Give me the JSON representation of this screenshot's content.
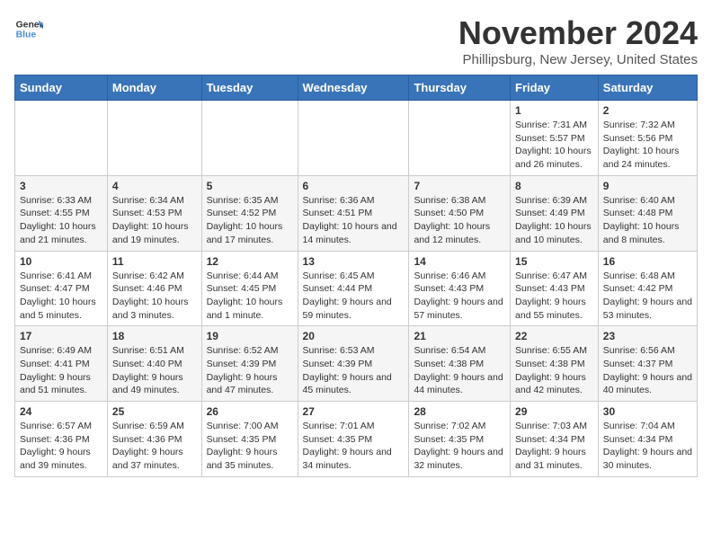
{
  "logo": {
    "line1": "General",
    "line2": "Blue"
  },
  "title": "November 2024",
  "subtitle": "Phillipsburg, New Jersey, United States",
  "days_of_week": [
    "Sunday",
    "Monday",
    "Tuesday",
    "Wednesday",
    "Thursday",
    "Friday",
    "Saturday"
  ],
  "weeks": [
    [
      {
        "day": "",
        "info": ""
      },
      {
        "day": "",
        "info": ""
      },
      {
        "day": "",
        "info": ""
      },
      {
        "day": "",
        "info": ""
      },
      {
        "day": "",
        "info": ""
      },
      {
        "day": "1",
        "info": "Sunrise: 7:31 AM\nSunset: 5:57 PM\nDaylight: 10 hours and 26 minutes."
      },
      {
        "day": "2",
        "info": "Sunrise: 7:32 AM\nSunset: 5:56 PM\nDaylight: 10 hours and 24 minutes."
      }
    ],
    [
      {
        "day": "3",
        "info": "Sunrise: 6:33 AM\nSunset: 4:55 PM\nDaylight: 10 hours and 21 minutes."
      },
      {
        "day": "4",
        "info": "Sunrise: 6:34 AM\nSunset: 4:53 PM\nDaylight: 10 hours and 19 minutes."
      },
      {
        "day": "5",
        "info": "Sunrise: 6:35 AM\nSunset: 4:52 PM\nDaylight: 10 hours and 17 minutes."
      },
      {
        "day": "6",
        "info": "Sunrise: 6:36 AM\nSunset: 4:51 PM\nDaylight: 10 hours and 14 minutes."
      },
      {
        "day": "7",
        "info": "Sunrise: 6:38 AM\nSunset: 4:50 PM\nDaylight: 10 hours and 12 minutes."
      },
      {
        "day": "8",
        "info": "Sunrise: 6:39 AM\nSunset: 4:49 PM\nDaylight: 10 hours and 10 minutes."
      },
      {
        "day": "9",
        "info": "Sunrise: 6:40 AM\nSunset: 4:48 PM\nDaylight: 10 hours and 8 minutes."
      }
    ],
    [
      {
        "day": "10",
        "info": "Sunrise: 6:41 AM\nSunset: 4:47 PM\nDaylight: 10 hours and 5 minutes."
      },
      {
        "day": "11",
        "info": "Sunrise: 6:42 AM\nSunset: 4:46 PM\nDaylight: 10 hours and 3 minutes."
      },
      {
        "day": "12",
        "info": "Sunrise: 6:44 AM\nSunset: 4:45 PM\nDaylight: 10 hours and 1 minute."
      },
      {
        "day": "13",
        "info": "Sunrise: 6:45 AM\nSunset: 4:44 PM\nDaylight: 9 hours and 59 minutes."
      },
      {
        "day": "14",
        "info": "Sunrise: 6:46 AM\nSunset: 4:43 PM\nDaylight: 9 hours and 57 minutes."
      },
      {
        "day": "15",
        "info": "Sunrise: 6:47 AM\nSunset: 4:43 PM\nDaylight: 9 hours and 55 minutes."
      },
      {
        "day": "16",
        "info": "Sunrise: 6:48 AM\nSunset: 4:42 PM\nDaylight: 9 hours and 53 minutes."
      }
    ],
    [
      {
        "day": "17",
        "info": "Sunrise: 6:49 AM\nSunset: 4:41 PM\nDaylight: 9 hours and 51 minutes."
      },
      {
        "day": "18",
        "info": "Sunrise: 6:51 AM\nSunset: 4:40 PM\nDaylight: 9 hours and 49 minutes."
      },
      {
        "day": "19",
        "info": "Sunrise: 6:52 AM\nSunset: 4:39 PM\nDaylight: 9 hours and 47 minutes."
      },
      {
        "day": "20",
        "info": "Sunrise: 6:53 AM\nSunset: 4:39 PM\nDaylight: 9 hours and 45 minutes."
      },
      {
        "day": "21",
        "info": "Sunrise: 6:54 AM\nSunset: 4:38 PM\nDaylight: 9 hours and 44 minutes."
      },
      {
        "day": "22",
        "info": "Sunrise: 6:55 AM\nSunset: 4:38 PM\nDaylight: 9 hours and 42 minutes."
      },
      {
        "day": "23",
        "info": "Sunrise: 6:56 AM\nSunset: 4:37 PM\nDaylight: 9 hours and 40 minutes."
      }
    ],
    [
      {
        "day": "24",
        "info": "Sunrise: 6:57 AM\nSunset: 4:36 PM\nDaylight: 9 hours and 39 minutes."
      },
      {
        "day": "25",
        "info": "Sunrise: 6:59 AM\nSunset: 4:36 PM\nDaylight: 9 hours and 37 minutes."
      },
      {
        "day": "26",
        "info": "Sunrise: 7:00 AM\nSunset: 4:35 PM\nDaylight: 9 hours and 35 minutes."
      },
      {
        "day": "27",
        "info": "Sunrise: 7:01 AM\nSunset: 4:35 PM\nDaylight: 9 hours and 34 minutes."
      },
      {
        "day": "28",
        "info": "Sunrise: 7:02 AM\nSunset: 4:35 PM\nDaylight: 9 hours and 32 minutes."
      },
      {
        "day": "29",
        "info": "Sunrise: 7:03 AM\nSunset: 4:34 PM\nDaylight: 9 hours and 31 minutes."
      },
      {
        "day": "30",
        "info": "Sunrise: 7:04 AM\nSunset: 4:34 PM\nDaylight: 9 hours and 30 minutes."
      }
    ]
  ]
}
